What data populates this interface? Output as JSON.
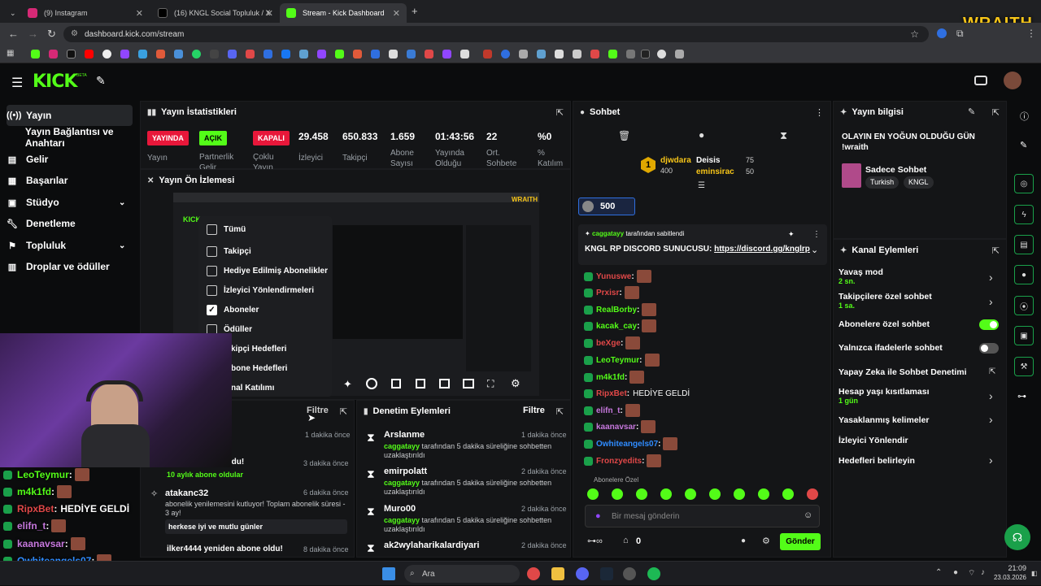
{
  "browser": {
    "tabs": [
      {
        "label": "(9) Instagram"
      },
      {
        "label": "(16) KNGL Social Topluluk / X"
      },
      {
        "label": "Stream - Kick Dashboard"
      }
    ],
    "url": "dashboard.kick.com/stream"
  },
  "overlay_logo": "WRAITH",
  "kick": {
    "logo": "KICK",
    "beta": "BETA"
  },
  "sidebar": {
    "items": [
      {
        "label": "Yayın"
      },
      {
        "label": "Yayın Bağlantısı ve Anahtarı"
      },
      {
        "label": "Gelir"
      },
      {
        "label": "Başarılar"
      },
      {
        "label": "Stüdyo"
      },
      {
        "label": "Denetleme"
      },
      {
        "label": "Topluluk"
      },
      {
        "label": "Droplar ve ödüller"
      }
    ]
  },
  "stats": {
    "title": "Yayın İstatistikleri",
    "badges": [
      {
        "label": "YAYINDA"
      },
      {
        "label": "AÇIK"
      },
      {
        "label": "KAPALI"
      }
    ],
    "values": [
      "29.458",
      "650.833",
      "1.659",
      "01:43:56",
      "22",
      "%0"
    ],
    "labels": [
      "Yayın",
      "Partnerlik Gelir",
      "Çoklu Yayın",
      "İzleyici",
      "Takipçi",
      "Abone Sayısı",
      "Yayında Olduğu",
      "Ort. Sohbete",
      "% Katılım"
    ]
  },
  "preview": {
    "title": "Yayın Ön İzlemesi",
    "menu": [
      {
        "label": "Tümü",
        "checked": false
      },
      {
        "label": "Takipçi",
        "checked": false
      },
      {
        "label": "Hediye Edilmiş Abonelikler",
        "checked": false
      },
      {
        "label": "İzleyici Yönlendirmeleri",
        "checked": false
      },
      {
        "label": "Aboneler",
        "checked": true
      },
      {
        "label": "Ödüller",
        "checked": false
      },
      {
        "label": "kipçi Hedefleri",
        "checked": false
      },
      {
        "label": "bone Hedefleri",
        "checked": false
      },
      {
        "label": "nal Katılımı",
        "checked": false
      }
    ]
  },
  "activity": {
    "filter": "Filtre",
    "items": [
      {
        "title": "",
        "time": "1 dakika önce",
        "sub": ""
      },
      {
        "title": "yeniden abone oldu!",
        "time": "3 dakika önce",
        "sub": "10 aylık abone oldular"
      },
      {
        "title": "atakanc32",
        "time": "6 dakika önce",
        "sub": "abonelik yenilemesini kutluyor! Toplam abonelik süresi - 3 ay!",
        "note": "herkese iyi ve mutlu günler"
      },
      {
        "title": "ilker4444 yeniden abone oldu!",
        "time": "8 dakika önce",
        "sub": ""
      }
    ]
  },
  "moderation": {
    "title": "Denetim Eylemleri",
    "filter": "Filtre",
    "items": [
      {
        "user": "Arslanme",
        "time": "1 dakika önce",
        "by": "caggatayy",
        "text": "tarafından 5 dakika süreliğine sohbetten uzaklaştırıldı"
      },
      {
        "user": "emirpolatt",
        "time": "2 dakika önce",
        "by": "caggatayy",
        "text": "tarafından 5 dakika süreliğine sohbetten uzaklaştırıldı"
      },
      {
        "user": "Muro00",
        "time": "2 dakika önce",
        "by": "caggatayy",
        "text": "tarafından 5 dakika süreliğine sohbetten uzaklaştırıldı"
      },
      {
        "user": "ak2wylaharikalardiyari",
        "time": "2 dakika önce",
        "by": "",
        "text": ""
      }
    ]
  },
  "chat": {
    "title": "Sohbet",
    "leaderboard": [
      {
        "rank": "1",
        "name": "djwdara",
        "value": "400"
      },
      {
        "rank": "",
        "name": "Deisis",
        "value": "75"
      },
      {
        "rank": "",
        "name": "eminsirac",
        "value": "50"
      }
    ],
    "gift_count": "500",
    "pinned_by": "caggatayy",
    "pinned_label": "tarafından sabitlendi",
    "pinned_text": "KNGL RP DISCORD SUNUCUSU:",
    "pinned_link": "https://discord.gg/knglrp",
    "messages": [
      {
        "user": "Yunuswe",
        "text": "",
        "color": "#e04848"
      },
      {
        "user": "Prxisr",
        "text": "",
        "color": "#e04848"
      },
      {
        "user": "RealBorby",
        "text": "",
        "color": "#53fc18"
      },
      {
        "user": "kacak_cay",
        "text": "",
        "color": "#53fc18"
      },
      {
        "user": "beXge",
        "text": "",
        "color": "#e04848"
      },
      {
        "user": "LeoTeymur",
        "text": "",
        "color": "#53fc18"
      },
      {
        "user": "m4k1fd",
        "text": "",
        "color": "#53fc18"
      },
      {
        "user": "RipxBet",
        "text": "HEDİYE GELDİ",
        "color": "#e04848"
      },
      {
        "user": "elifn_t",
        "text": "",
        "color": "#c678dd"
      },
      {
        "user": "kaanavsar",
        "text": "",
        "color": "#c678dd"
      },
      {
        "user": "Owhiteangels07",
        "text": "",
        "color": "#2f8cff"
      },
      {
        "user": "Fronzyedits",
        "text": "",
        "color": "#e04848"
      }
    ],
    "emote_tab": "Abonelere Özel",
    "input_placeholder": "Bir mesaj gönderin",
    "points": "0",
    "send_label": "Gönder"
  },
  "stream_info": {
    "title": "Yayın bilgisi",
    "stream_title": "OLAYIN EN YOĞUN OLDUĞU GÜN !wraith",
    "category": "Sadece Sohbet",
    "tags": [
      "Turkish",
      "KNGL"
    ]
  },
  "channel_actions": {
    "title": "Kanal Eylemleri",
    "rows": [
      {
        "label": "Yavaş mod",
        "sub": "2 sn."
      },
      {
        "label": "Takipçilere özel sohbet",
        "sub": "1 sa."
      },
      {
        "label": "Abonelere özel sohbet",
        "sub": ""
      },
      {
        "label": "Yalnızca ifadelerle sohbet",
        "sub": ""
      },
      {
        "label": "Yapay Zeka ile Sohbet Denetimi",
        "sub": ""
      },
      {
        "label": "Hesap yaşı kısıtlaması",
        "sub": "1 gün"
      },
      {
        "label": "Yasaklanmış kelimeler",
        "sub": ""
      },
      {
        "label": "İzleyici Yönlendir",
        "sub": ""
      },
      {
        "label": "Hedefleri belirleyin",
        "sub": ""
      }
    ],
    "toggles": {
      "subscriber_only": true,
      "emote_only": false
    }
  },
  "overlay_chat": [
    {
      "user": "LeoTeymur",
      "text": "",
      "color": "#53fc18"
    },
    {
      "user": "m4k1fd",
      "text": "",
      "color": "#53fc18"
    },
    {
      "user": "RipxBet",
      "text": "HEDİYE GELDİ",
      "color": "#e04848"
    },
    {
      "user": "elifn_t",
      "text": "",
      "color": "#c678dd"
    },
    {
      "user": "kaanavsar",
      "text": "",
      "color": "#c678dd"
    },
    {
      "user": "Owhiteangels07",
      "text": "",
      "color": "#2f8cff"
    },
    {
      "user": "Fronzyedits",
      "text": "",
      "color": "#e04848"
    }
  ],
  "taskbar": {
    "search": "Ara",
    "time": "21:09",
    "date": "23.03.2026"
  },
  "colors": {
    "accent": "#53fc18",
    "live": "#e8173a",
    "bg": "#0b0c0d",
    "panel": "#141517"
  }
}
